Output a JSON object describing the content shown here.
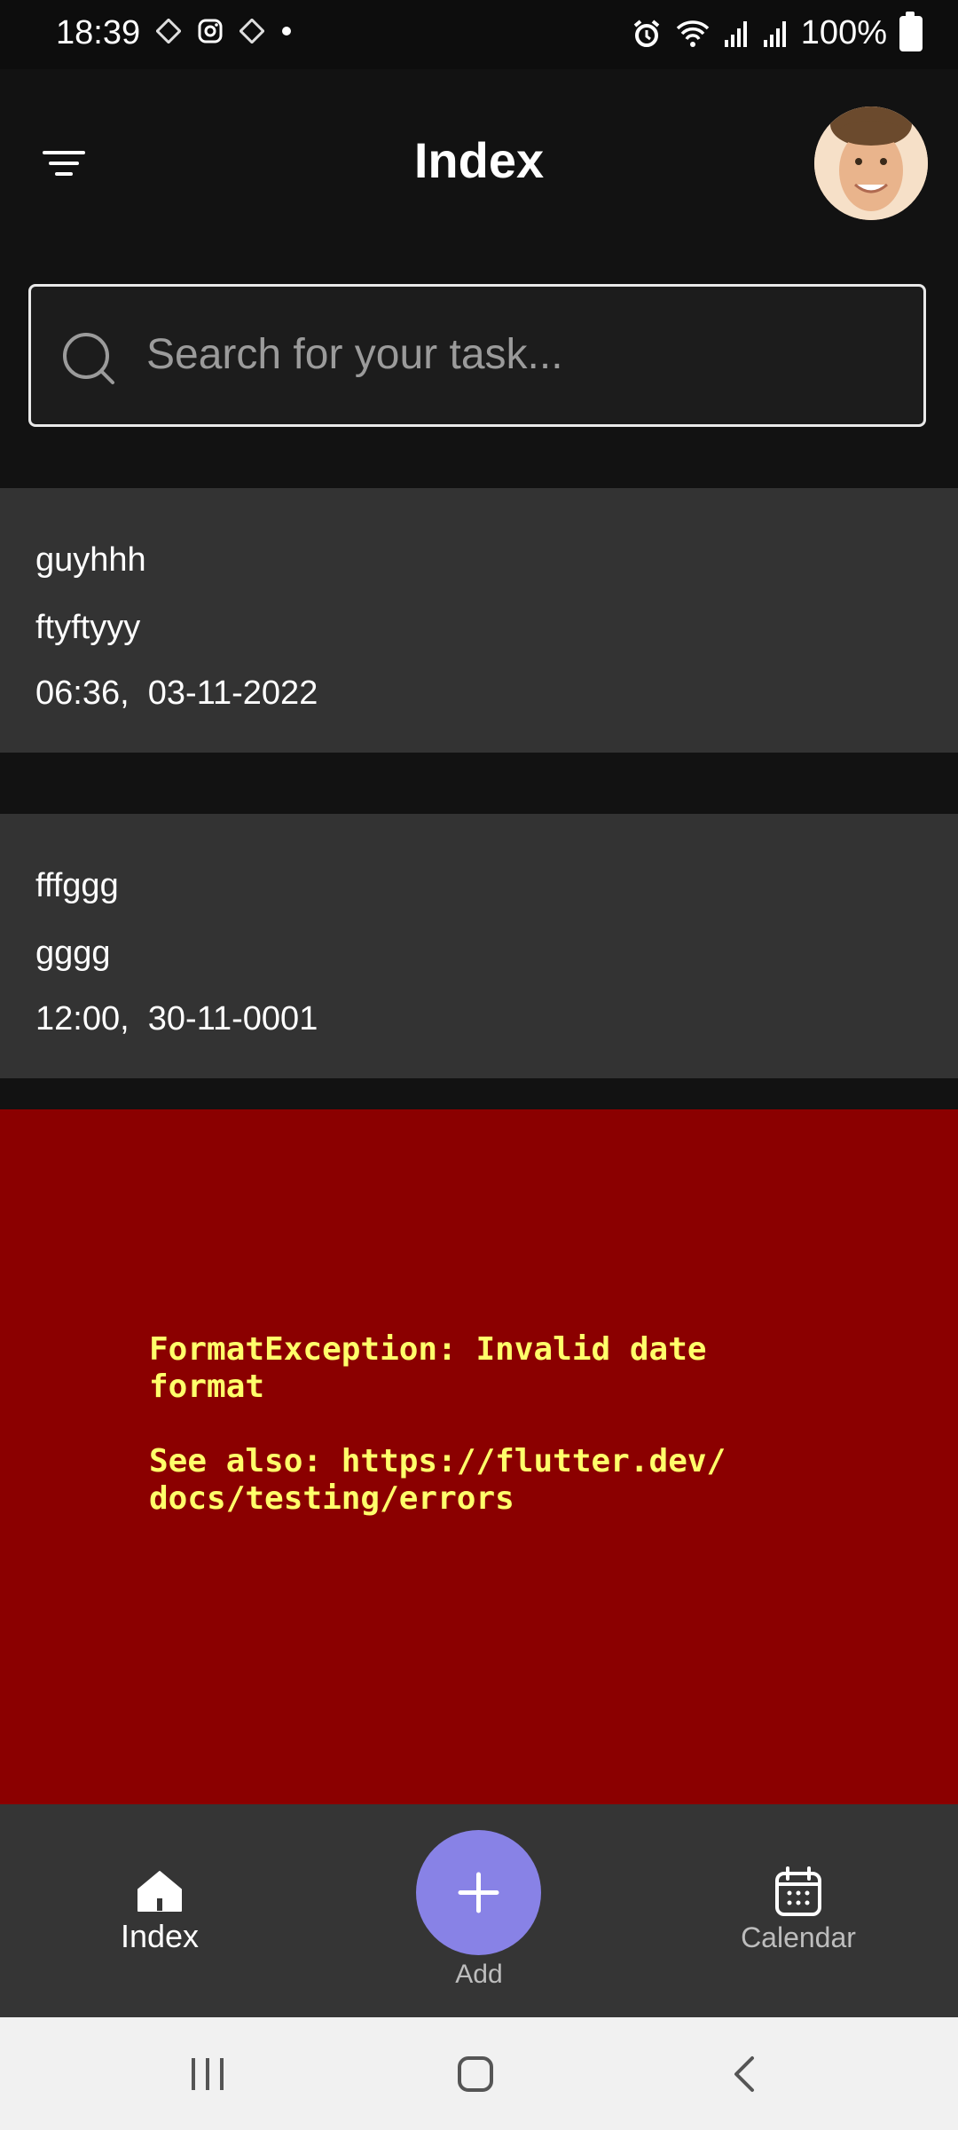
{
  "status": {
    "time": "18:39",
    "battery": "100%",
    "left_icons": [
      "diamond-app-icon",
      "instagram-icon",
      "diamond-app-icon",
      "dot-icon"
    ],
    "right_icons": [
      "alarm-icon",
      "wifi-icon",
      "signal-icon",
      "signal-icon",
      "battery-icon"
    ]
  },
  "header": {
    "title": "Index",
    "menu_icon": "filter-menu-icon"
  },
  "search": {
    "placeholder": "Search for your task..."
  },
  "tasks": [
    {
      "title": "guyhhh",
      "description": "ftyftyyy",
      "datetime": "06:36,  03-11-2022"
    },
    {
      "title": "fffggg",
      "description": "gggg",
      "datetime": "12:00,  30-11-0001"
    }
  ],
  "error": {
    "message": "FormatException: Invalid date\nformat\n\nSee also: https://flutter.dev/\ndocs/testing/errors"
  },
  "bottom_nav": {
    "index_label": "Index",
    "add_label": "Add",
    "calendar_label": "Calendar"
  },
  "colors": {
    "accent": "#8882e6",
    "error_bg": "#8b0000",
    "error_text": "#ffff6a",
    "card_bg": "#333333"
  }
}
